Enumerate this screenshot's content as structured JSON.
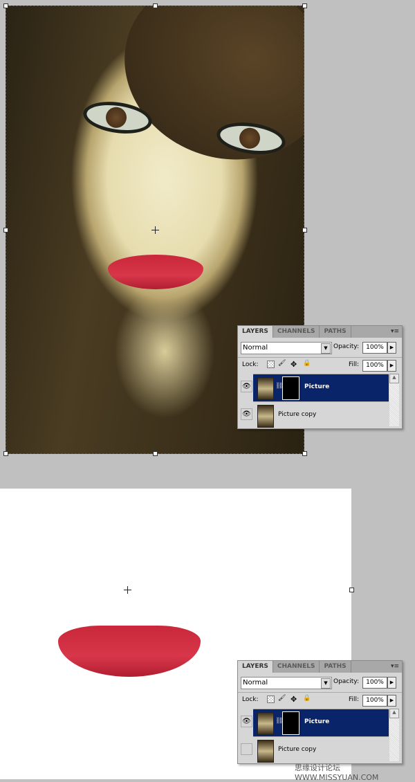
{
  "panels": [
    {
      "tabs": [
        "LAYERS",
        "CHANNELS",
        "PATHS"
      ],
      "menu_icon": "panel-menu-icon",
      "blend_mode": "Normal",
      "opacity_label": "Opacity:",
      "opacity": "100%",
      "lock_label": "Lock:",
      "fill_label": "Fill:",
      "fill": "100%",
      "layers": [
        {
          "name": "Picture",
          "visible": true,
          "selected": true,
          "has_mask": true
        },
        {
          "name": "Picture copy",
          "visible": true,
          "selected": false
        }
      ]
    },
    {
      "tabs": [
        "LAYERS",
        "CHANNELS",
        "PATHS"
      ],
      "menu_icon": "panel-menu-icon",
      "blend_mode": "Normal",
      "opacity_label": "Opacity:",
      "opacity": "100%",
      "lock_label": "Lock:",
      "fill_label": "Fill:",
      "fill": "100%",
      "layers": [
        {
          "name": "Picture",
          "visible": true,
          "selected": true,
          "has_mask": true
        },
        {
          "name": "Picture copy",
          "visible": false,
          "selected": false
        }
      ]
    }
  ],
  "watermark": "思缘设计论坛 WWW.MISSYUAN.COM",
  "colors": {
    "selection": "#0a246a",
    "background": "#c0c0c0",
    "lips": "#d0303f"
  }
}
